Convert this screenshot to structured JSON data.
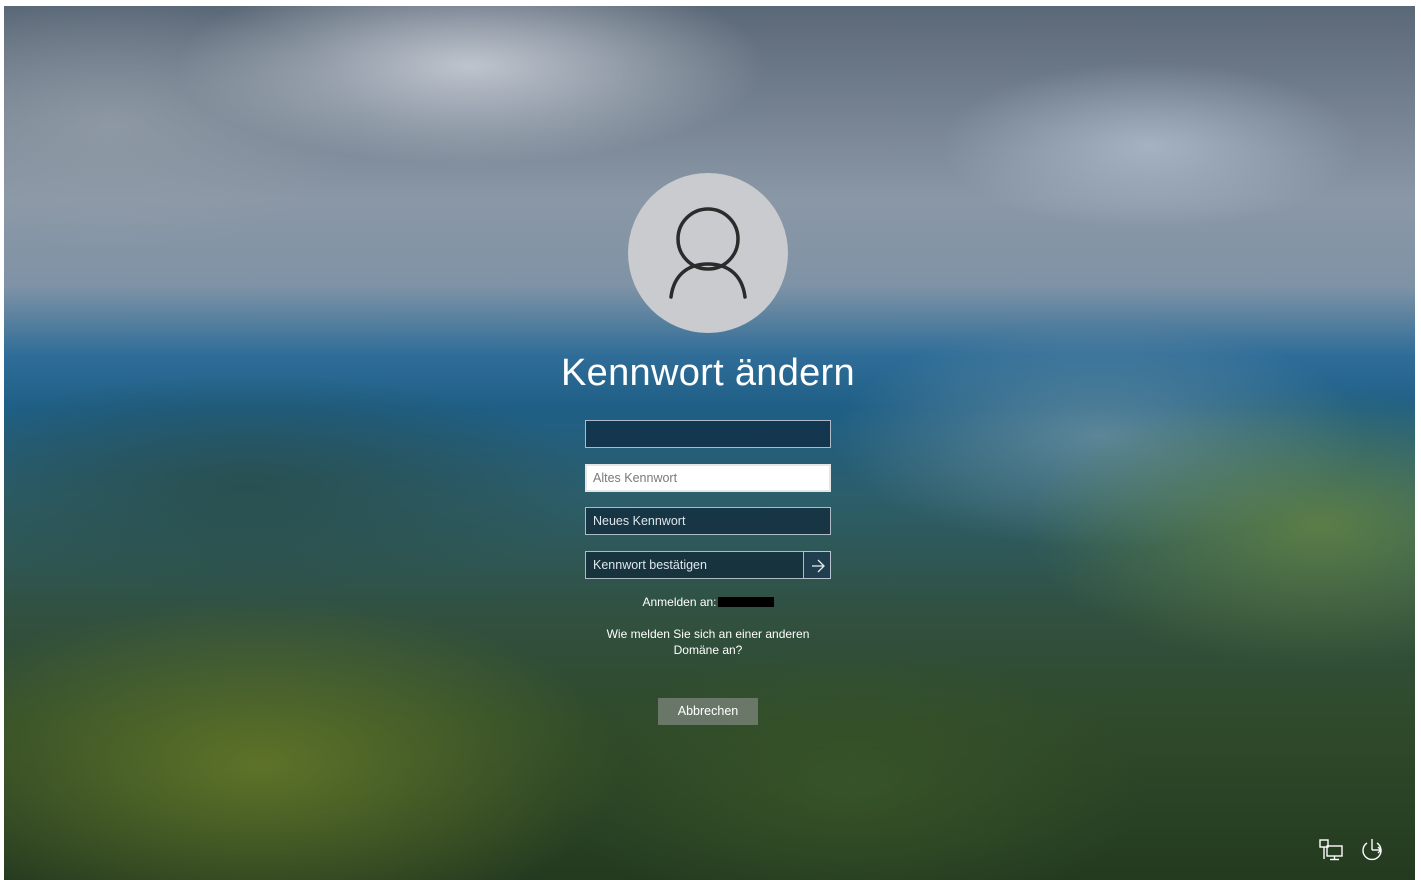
{
  "dialog": {
    "title": "Kennwort ändern",
    "username_value": "",
    "old_password_placeholder": "Altes Kennwort",
    "new_password_placeholder": "Neues Kennwort",
    "confirm_password_placeholder": "Kennwort bestätigen",
    "sign_in_to_label": "Anmelden an:",
    "other_domain_link": "Wie melden Sie sich an einer anderen Domäne an?",
    "cancel_button": "Abbrechen"
  },
  "icons": {
    "avatar": "user-avatar-icon",
    "submit": "arrow-right-icon",
    "network": "network-icon",
    "accessibility_power": "power-icon"
  },
  "colors": {
    "text": "#ffffff",
    "field_bg": "#0a1e32",
    "active_field_bg": "#ffffff",
    "button_bg": "#78827a",
    "avatar_bg": "#c9cbcf"
  }
}
